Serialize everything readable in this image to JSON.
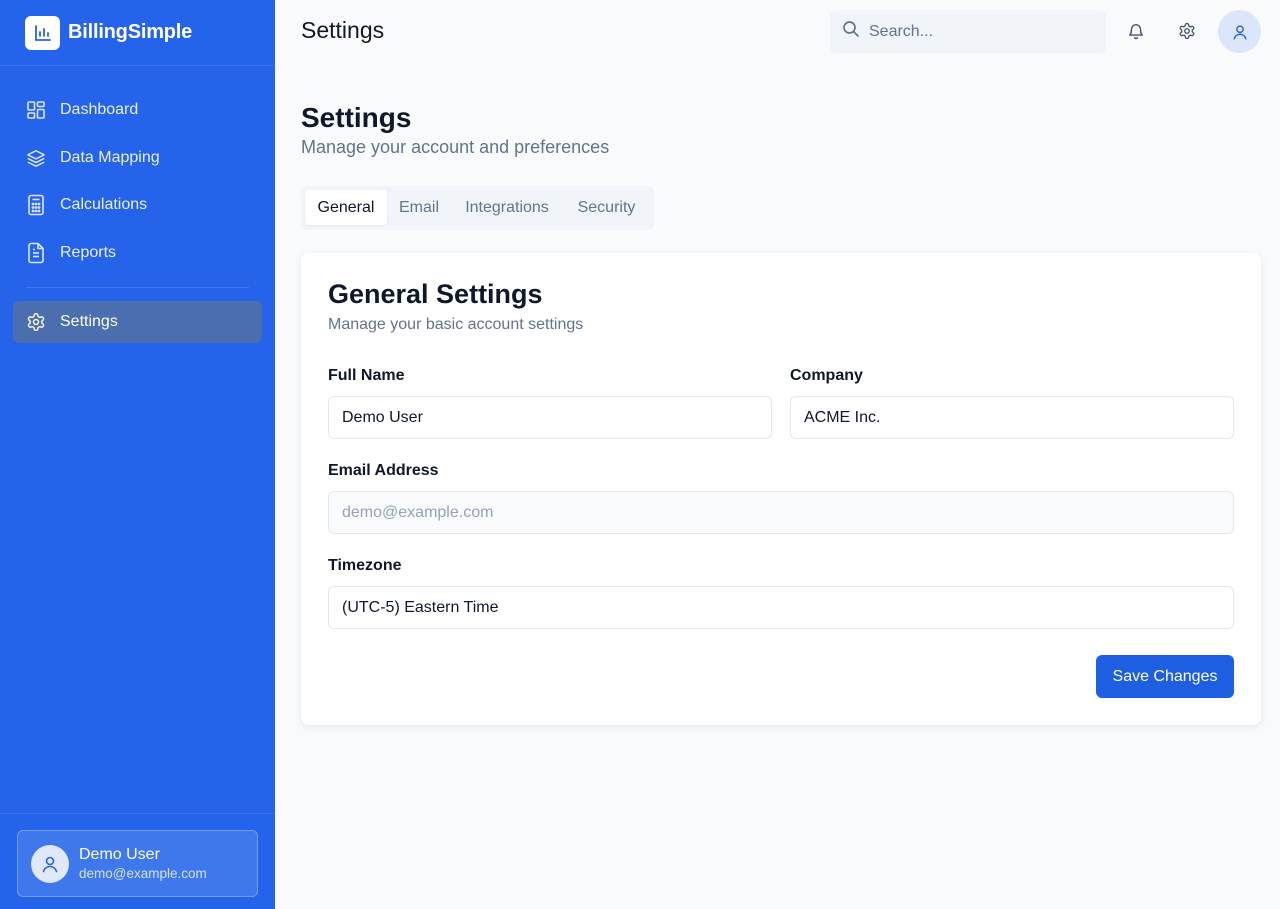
{
  "app": {
    "name": "BillingSimple"
  },
  "colors": {
    "sidebar": "#2563eb",
    "accent": "#1d5fe0",
    "active_nav": "#4a6eae",
    "background": "#f8fafc"
  },
  "sidebar": {
    "items": [
      {
        "label": "Dashboard",
        "icon": "dashboard-icon"
      },
      {
        "label": "Data Mapping",
        "icon": "layers-icon"
      },
      {
        "label": "Calculations",
        "icon": "calculator-icon"
      },
      {
        "label": "Reports",
        "icon": "file-text-icon"
      },
      {
        "label": "Settings",
        "icon": "gear-icon",
        "active": true
      }
    ],
    "user": {
      "name": "Demo User",
      "email": "demo@example.com",
      "icon": "user-icon"
    }
  },
  "header": {
    "title": "Settings",
    "search_placeholder": "Search...",
    "icons": [
      "bell-icon",
      "gear-icon",
      "user-icon"
    ]
  },
  "page": {
    "title": "Settings",
    "subtitle": "Manage your account and preferences",
    "tabs": [
      {
        "label": "General",
        "active": true
      },
      {
        "label": "Email"
      },
      {
        "label": "Integrations"
      },
      {
        "label": "Security"
      }
    ]
  },
  "card": {
    "title": "General Settings",
    "subtitle": "Manage your basic account settings",
    "fields": {
      "full_name": {
        "label": "Full Name",
        "value": "Demo User"
      },
      "company": {
        "label": "Company",
        "value": "ACME Inc."
      },
      "email": {
        "label": "Email Address",
        "placeholder": "demo@example.com"
      },
      "timezone": {
        "label": "Timezone",
        "value": "(UTC-5) Eastern Time"
      }
    },
    "save_label": "Save Changes"
  }
}
